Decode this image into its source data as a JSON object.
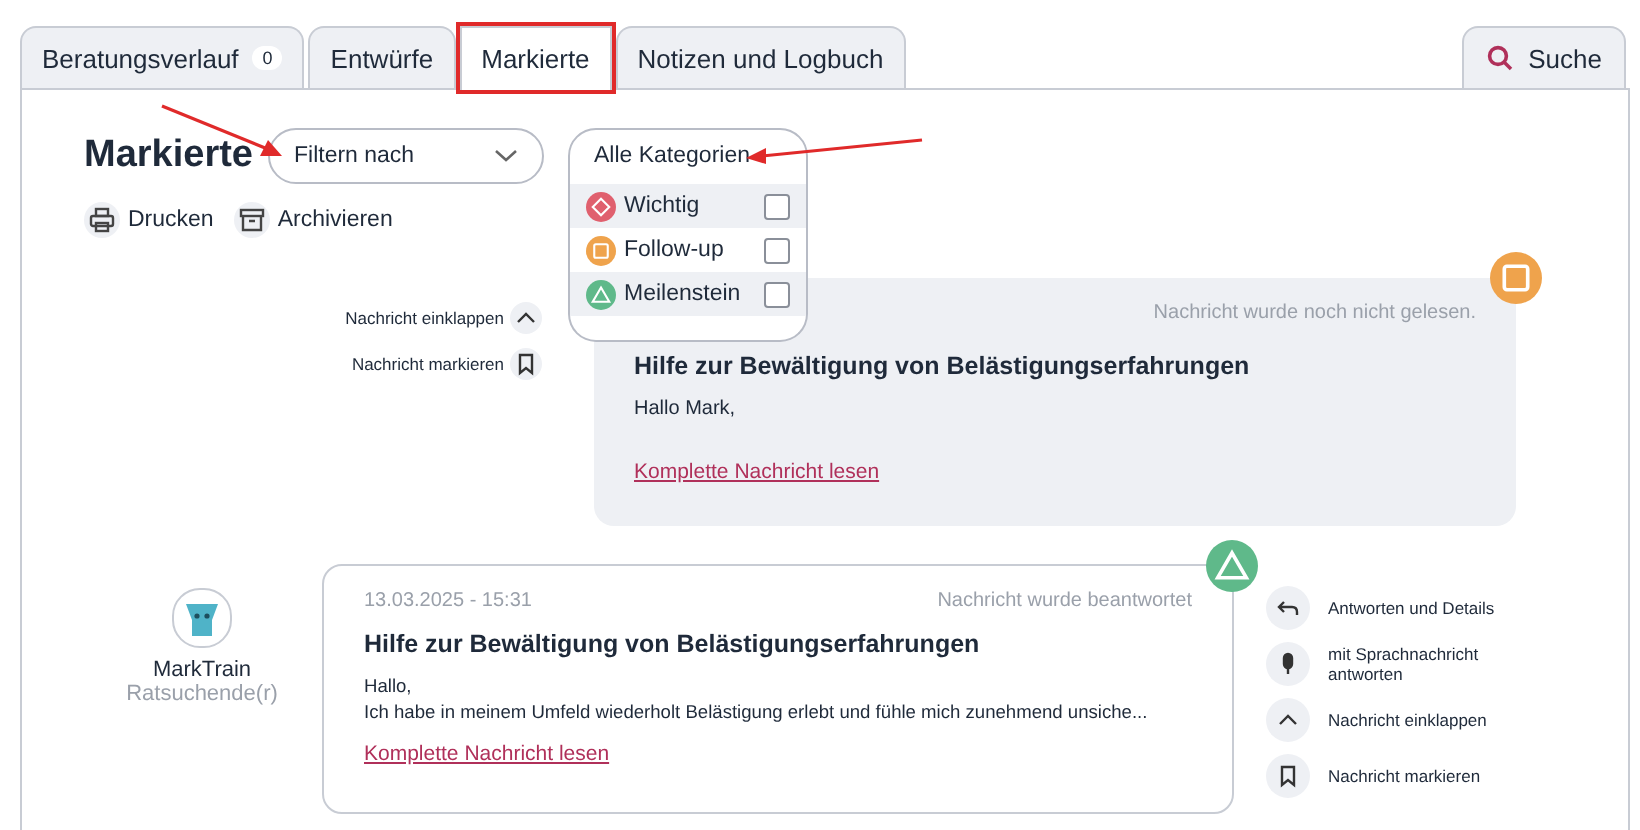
{
  "tabs": [
    {
      "label": "Beratungsverlauf",
      "badge": "0",
      "selected": false,
      "highlighted": false
    },
    {
      "label": "Entwürfe",
      "selected": false,
      "highlighted": false
    },
    {
      "label": "Markierte",
      "selected": true,
      "highlighted": true
    },
    {
      "label": "Notizen und Logbuch",
      "selected": false,
      "highlighted": false
    }
  ],
  "search_tab": {
    "label": "Suche"
  },
  "page_title": "Markierte",
  "filter_select": {
    "value": "Filtern nach"
  },
  "category_select": {
    "value": "Alle Kategorien",
    "expanded": true,
    "options": [
      {
        "label": "Wichtig",
        "kind": "diamond",
        "color": "#e0606e",
        "checked": false
      },
      {
        "label": "Follow-up",
        "kind": "square",
        "color": "#efa34c",
        "checked": false
      },
      {
        "label": "Meilenstein",
        "kind": "triangle",
        "color": "#5fb98a",
        "checked": false
      }
    ]
  },
  "toolbar": [
    {
      "kind": "print",
      "label": "Drucken"
    },
    {
      "kind": "archive",
      "label": "Archivieren"
    }
  ],
  "messages": [
    {
      "kind": "outgoing",
      "status": "Nachricht wurde noch nicht gelesen.",
      "subject": "Hilfe zur Bewältigung von Belästigungserfahrungen",
      "body": [
        "Hallo Mark,"
      ],
      "link": "Komplette Nachricht lesen",
      "marker": {
        "kind": "square",
        "color": "#efa34c"
      },
      "actions": [
        {
          "kind": "collapse",
          "label": "Nachricht einklappen"
        },
        {
          "kind": "bookmark",
          "label": "Nachricht markieren"
        }
      ]
    },
    {
      "kind": "incoming",
      "author": "MarkTrain",
      "role": "Ratsuchende(r)",
      "date": "13.03.2025 - 15:31",
      "status": "Nachricht wurde beantwortet",
      "subject": "Hilfe zur Bewältigung von Belästigungserfahrungen",
      "body": [
        "Hallo,",
        "Ich habe in meinem Umfeld wiederholt Belästigung erlebt und fühle mich zunehmend unsiche..."
      ],
      "link": "Komplette Nachricht lesen",
      "marker": {
        "kind": "triangle",
        "color": "#5fb98a"
      },
      "actions": [
        {
          "kind": "reply",
          "label": "Antworten und Details"
        },
        {
          "kind": "voice",
          "label": "mit Sprachnachricht antworten"
        },
        {
          "kind": "collapse",
          "label": "Nachricht einklappen"
        },
        {
          "kind": "bookmark",
          "label": "Nachricht markieren"
        }
      ]
    }
  ]
}
